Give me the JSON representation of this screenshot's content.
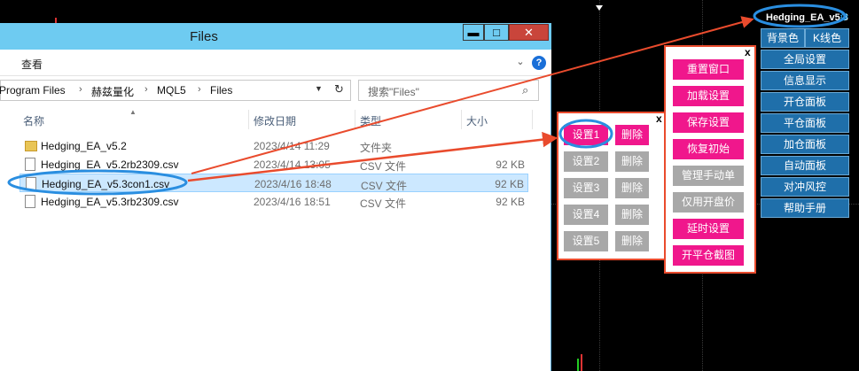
{
  "explorer": {
    "title": "Files",
    "controls": {
      "minimize": "▬",
      "maximize": "□",
      "close": "✕"
    },
    "menu": {
      "view": "查看"
    },
    "breadcrumb": [
      "Program Files",
      "赫兹量化",
      "MQL5",
      "Files"
    ],
    "search_placeholder": "搜索\"Files\"",
    "columns": {
      "name": "名称",
      "date": "修改日期",
      "type": "类型",
      "size": "大小"
    },
    "files": [
      {
        "name": "Hedging_EA_v5.2",
        "date": "2023/4/14 11:29",
        "type": "文件夹",
        "size": "",
        "kind": "folder",
        "selected": false
      },
      {
        "name": "Hedging_EA_v5.2rb2309.csv",
        "date": "2023/4/14 13:05",
        "type": "CSV 文件",
        "size": "92 KB",
        "kind": "doc",
        "selected": false
      },
      {
        "name": "Hedging_EA_v5.3con1.csv",
        "date": "2023/4/16 18:48",
        "type": "CSV 文件",
        "size": "92 KB",
        "kind": "doc",
        "selected": true
      },
      {
        "name": "Hedging_EA_v5.3rb2309.csv",
        "date": "2023/4/16 18:51",
        "type": "CSV 文件",
        "size": "92 KB",
        "kind": "doc",
        "selected": false
      }
    ]
  },
  "saves_panel": {
    "close": "x",
    "slots": [
      {
        "load": "设置1",
        "delete": "删除",
        "active": true
      },
      {
        "load": "设置2",
        "delete": "删除",
        "active": false
      },
      {
        "load": "设置3",
        "delete": "删除",
        "active": false
      },
      {
        "load": "设置4",
        "delete": "删除",
        "active": false
      },
      {
        "load": "设置5",
        "delete": "删除",
        "active": false
      }
    ]
  },
  "mid_panel": {
    "close": "x",
    "buttons": [
      {
        "label": "重置窗口",
        "style": "pink"
      },
      {
        "label": "加载设置",
        "style": "pink"
      },
      {
        "label": "保存设置",
        "style": "pink"
      },
      {
        "label": "恢复初始",
        "style": "pink"
      },
      {
        "label": "管理手动单",
        "style": "grey"
      },
      {
        "label": "仅用开盘价",
        "style": "grey"
      },
      {
        "label": "延时设置",
        "style": "pink"
      },
      {
        "label": "开平仓截图",
        "style": "pink"
      }
    ]
  },
  "right_panel": {
    "ea_name": "Hedging_EA_v5.3",
    "settings_icon": "⚙",
    "top_row": [
      "背景色",
      "K线色"
    ],
    "buttons": [
      "全局设置",
      "信息显示",
      "开仓面板",
      "平仓面板",
      "加仓面板",
      "自动面板",
      "对冲风控",
      "帮助手册"
    ]
  },
  "colors": {
    "accent_pink": "#f0178c",
    "disabled_grey": "#a8a8a8",
    "panel_blue": "#1f6faa",
    "annotation_red": "#e94b2d",
    "highlight_blue": "#2a8ee0"
  }
}
